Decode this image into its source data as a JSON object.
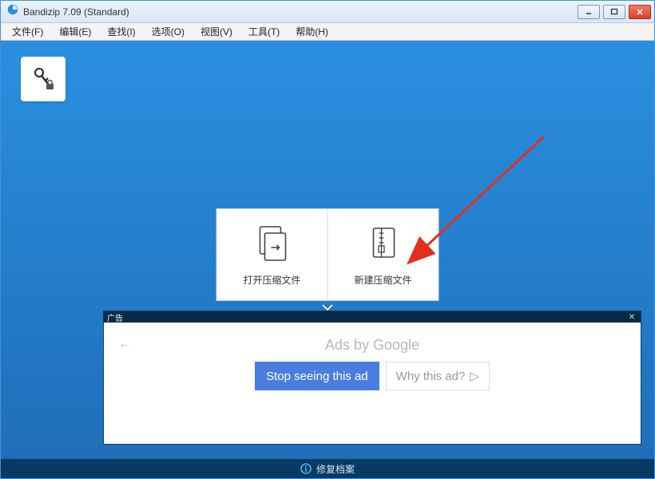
{
  "title": "Bandizip 7.09 (Standard)",
  "menu": {
    "file": "文件(F)",
    "edit": "编辑(E)",
    "find": "查找(I)",
    "options": "选项(O)",
    "view": "视图(V)",
    "tools": "工具(T)",
    "help": "帮助(H)"
  },
  "tiles": {
    "open_archive": "打开压缩文件",
    "new_archive": "新建压缩文件"
  },
  "ad": {
    "panel_title": "广告",
    "ads_by_prefix": "Ads by ",
    "ads_by_brand": "Google",
    "stop_label": "Stop seeing this ad",
    "why_label": "Why this ad?"
  },
  "status": {
    "repair_label": "修复档案"
  }
}
